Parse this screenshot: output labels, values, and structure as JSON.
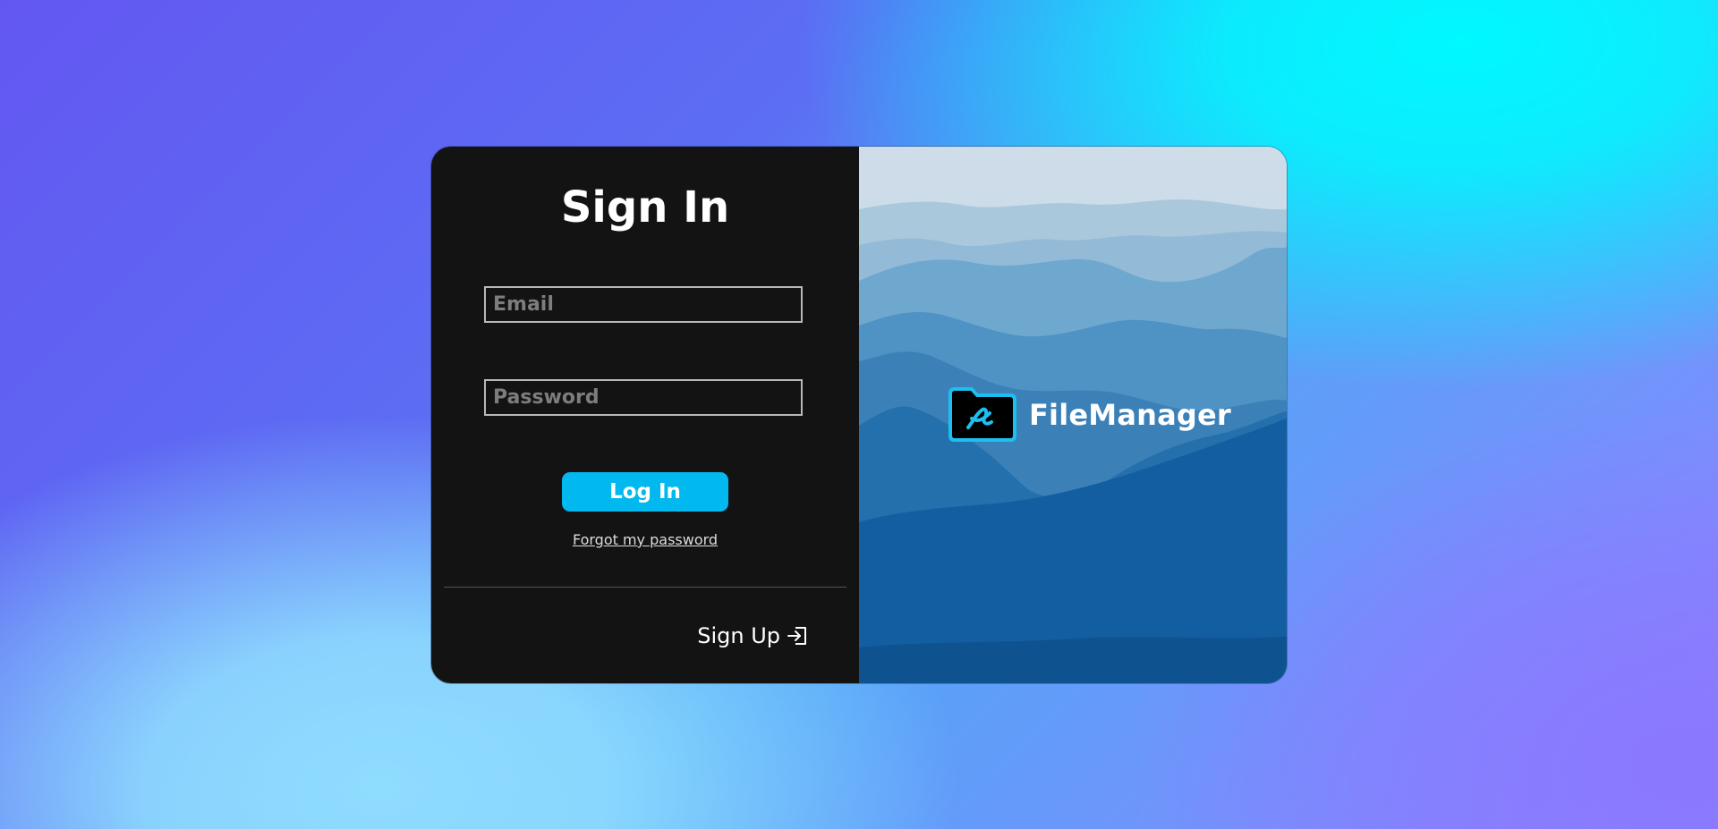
{
  "colors": {
    "card_left_bg": "#131313",
    "accent": "#02b9ef",
    "field_border": "#b8b8b8",
    "placeholder": "#7d7d7d"
  },
  "signin": {
    "title": "Sign In",
    "email_placeholder": "Email",
    "email_value": "",
    "password_placeholder": "Password",
    "password_value": "",
    "login_label": "Log In",
    "forgot_label": "Forgot my password",
    "signup_label": "Sign Up",
    "signup_icon": "sign-in-arrow-icon"
  },
  "brand": {
    "name": "FileManager",
    "icon": "folder-icon"
  },
  "hero": {
    "image": "misty-blue-mountains"
  }
}
